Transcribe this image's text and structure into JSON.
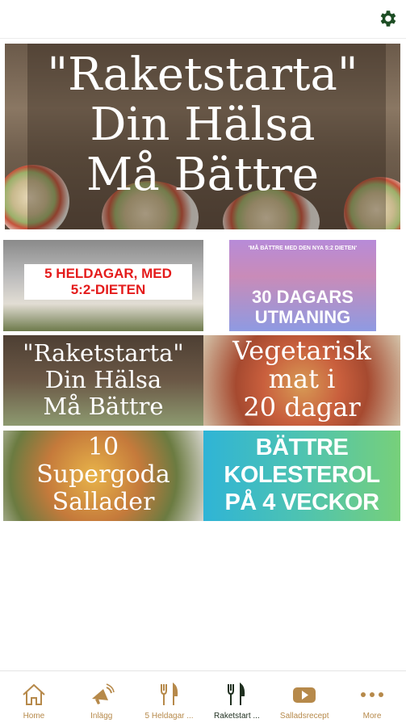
{
  "header": {
    "settings_icon": "gear-icon",
    "accent": "#1d4d24"
  },
  "hero": {
    "line1": "\"Raketstarta\"",
    "line2": "Din Hälsa",
    "line3": "Må Bättre"
  },
  "tiles": [
    {
      "line1": "5 HELDAGAR, MED",
      "line2": "5:2-DIETEN"
    },
    {
      "small": "'MÅ BÄTTRE MED DEN NYA 5:2 DIETEN'",
      "line1": "30 DAGARS",
      "line2": "UTMANING"
    },
    {
      "line1": "\"Raketstarta\"",
      "line2": "Din Hälsa",
      "line3": "Må Bättre"
    },
    {
      "line1": "Vegetarisk",
      "line2": "mat i",
      "line3": "20 dagar"
    },
    {
      "line1": "10",
      "line2": "Supergoda",
      "line3": "Sallader"
    },
    {
      "line1": "BÄTTRE",
      "line2": "KOLESTEROL",
      "line3": "PÅ 4 VECKOR"
    }
  ],
  "tabbar": {
    "items": [
      {
        "label": "Home",
        "icon": "home-icon"
      },
      {
        "label": "Inlägg",
        "icon": "megaphone-icon"
      },
      {
        "label": "5 Heldagar ...",
        "icon": "fork-knife-icon"
      },
      {
        "label": "Raketstart ...",
        "icon": "fork-knife-icon"
      },
      {
        "label": "Salladsrecept",
        "icon": "play-icon"
      },
      {
        "label": "More",
        "icon": "more-dots-icon"
      }
    ],
    "active_index": 3,
    "color_inactive": "#b6894a",
    "color_active": "#1f2f1f"
  }
}
